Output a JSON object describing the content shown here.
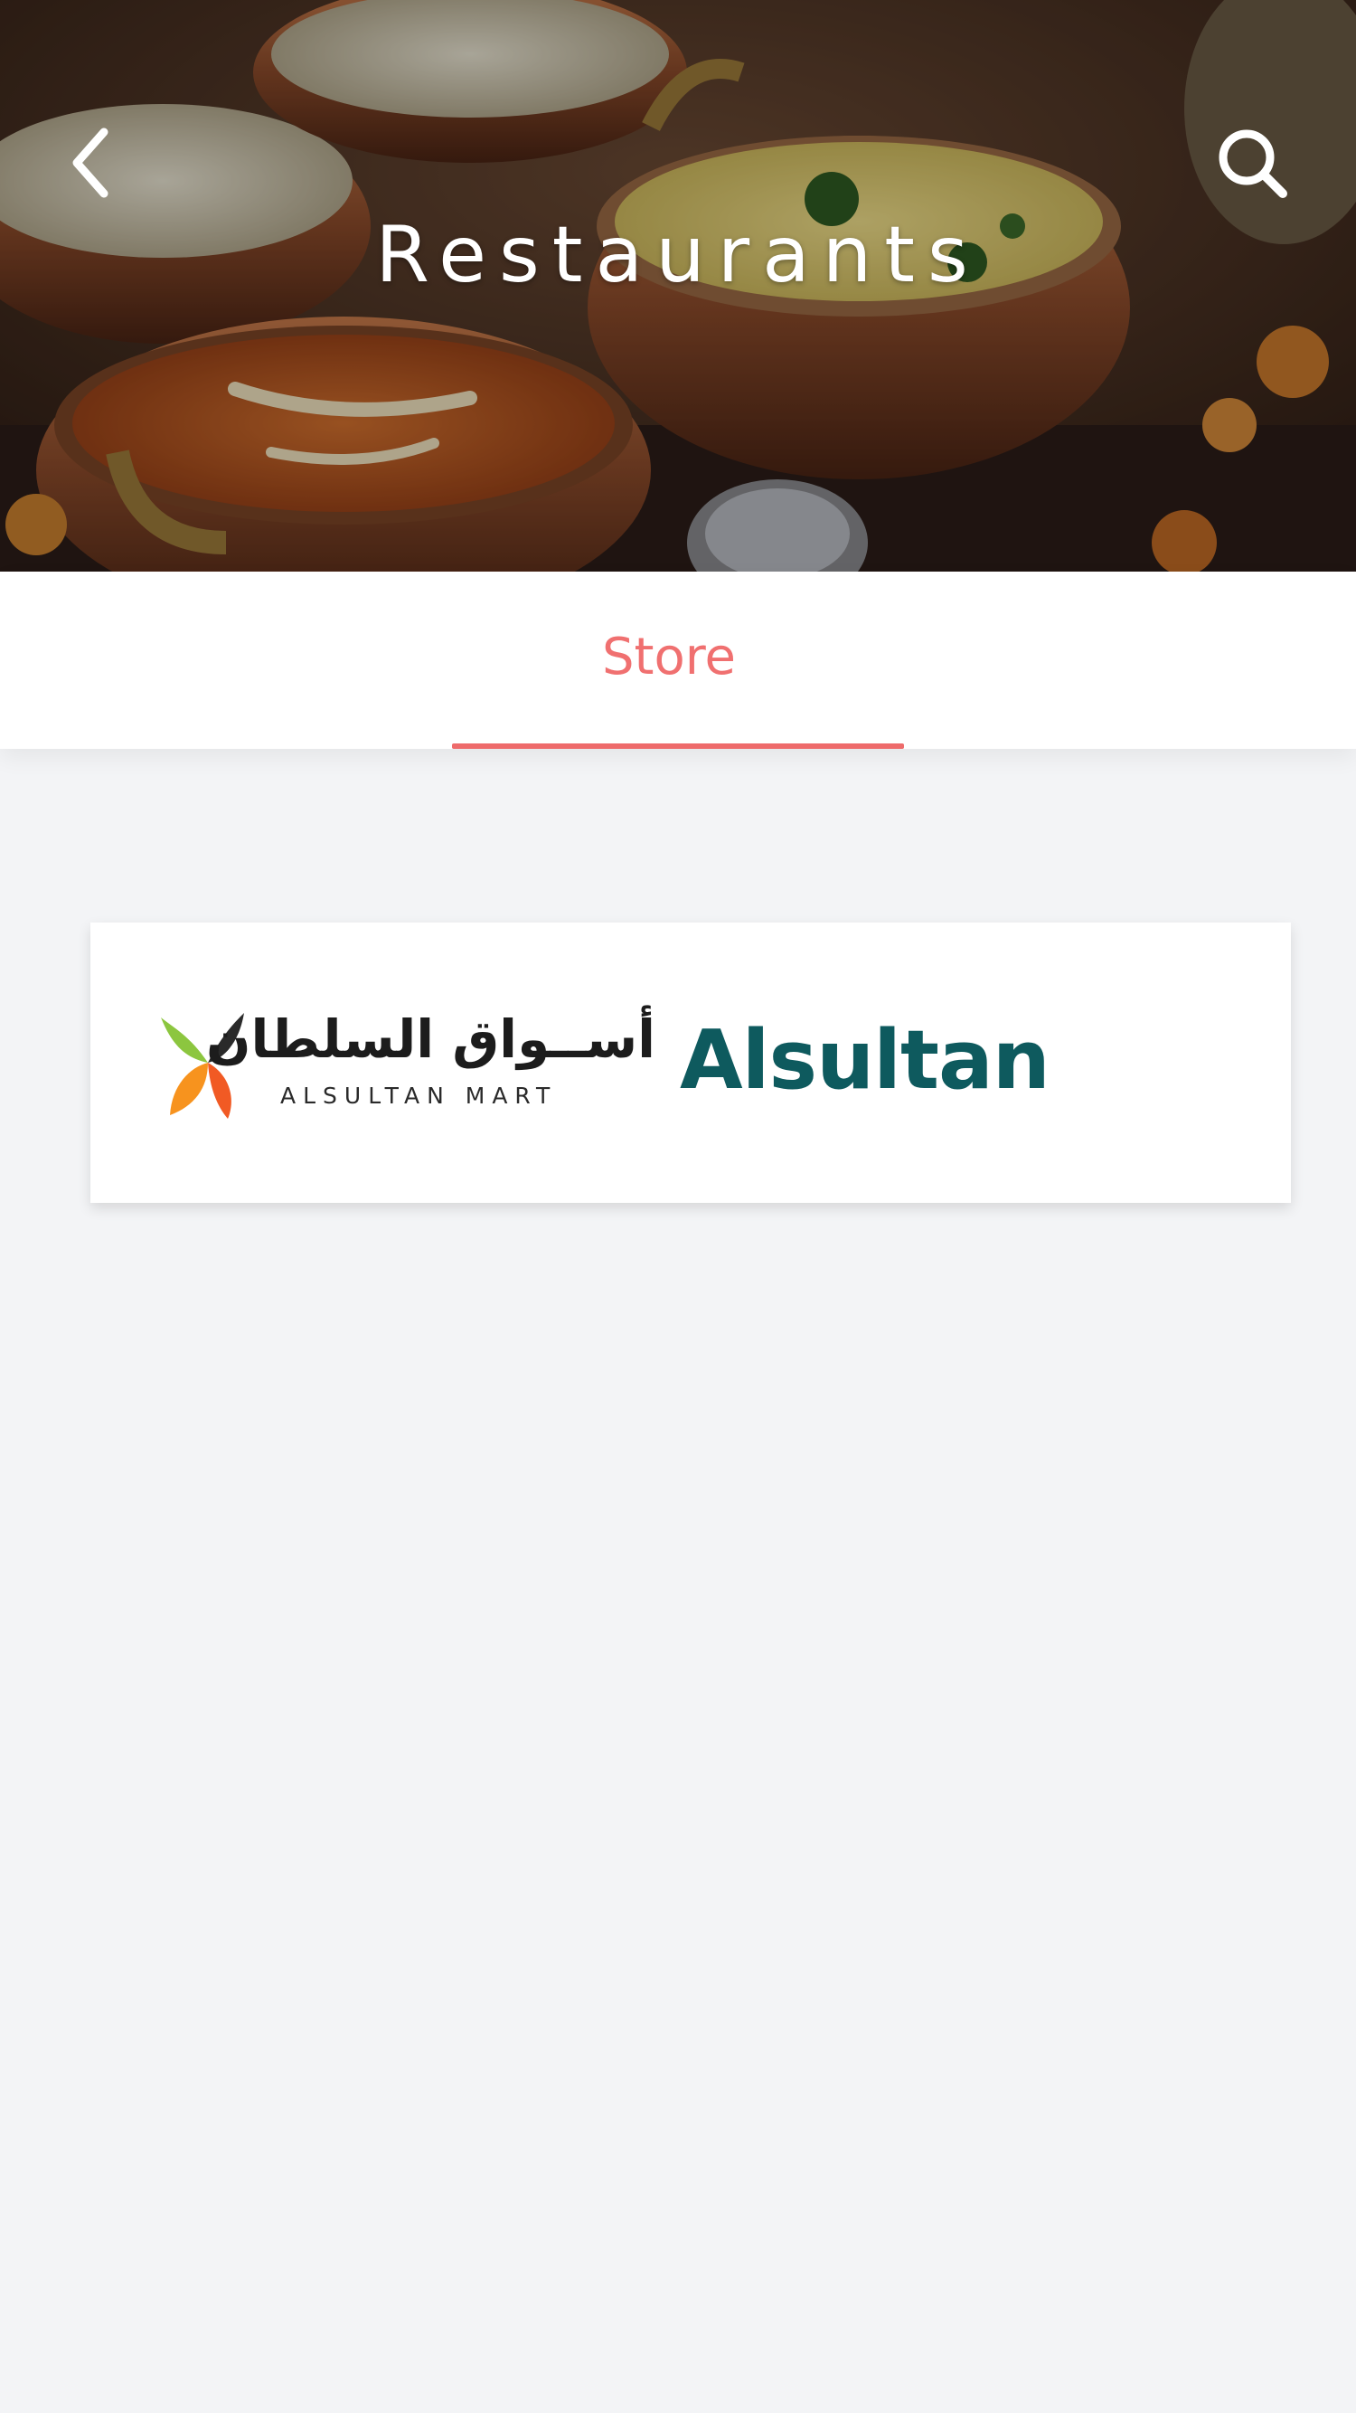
{
  "header": {
    "title": "Restaurants",
    "back_icon": "chevron-left-icon",
    "search_icon": "search-icon",
    "hero_image": "food-dishes-photo"
  },
  "tabs": [
    {
      "label": "Store",
      "active": true
    }
  ],
  "stores": [
    {
      "name": "Alsultan",
      "logo_arabic": "أســواق السلطان",
      "logo_latin": "ALSULTAN MART",
      "name_color": "#0e5a5e"
    }
  ],
  "colors": {
    "accent": "#ee6b6b",
    "background": "#f3f4f6",
    "card": "#ffffff"
  }
}
